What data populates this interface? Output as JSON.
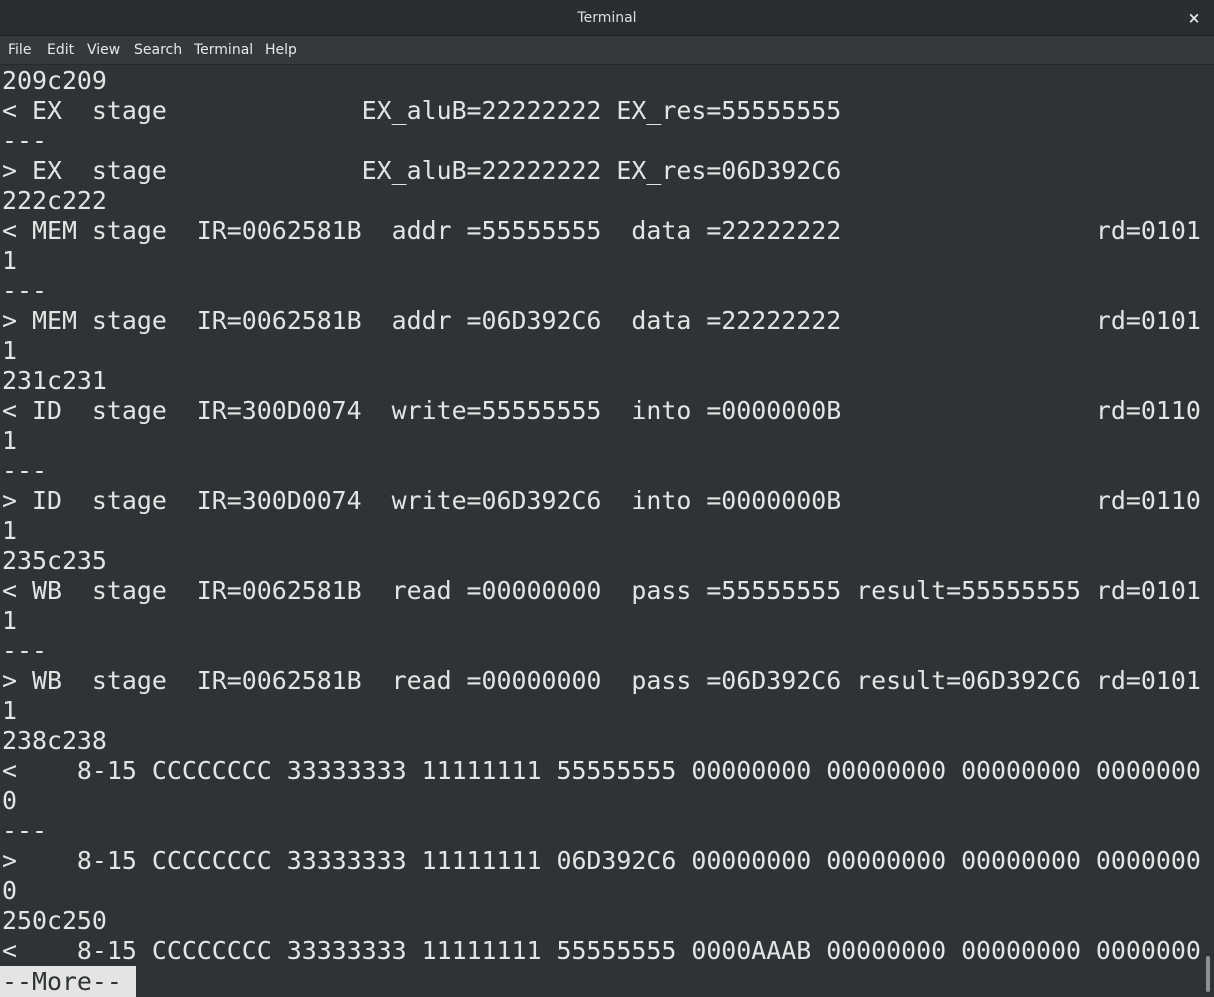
{
  "window": {
    "title": "Terminal",
    "close_label": "×"
  },
  "menu": {
    "items": [
      "File",
      "Edit",
      "View",
      "Search",
      "Terminal",
      "Help"
    ]
  },
  "terminal": {
    "lines": [
      "209c209",
      "< EX  stage             EX_aluB=22222222 EX_res=55555555",
      "---",
      "> EX  stage             EX_aluB=22222222 EX_res=06D392C6",
      "222c222",
      "< MEM stage  IR=0062581B  addr =55555555  data =22222222                 rd=0101",
      "1",
      "---",
      "> MEM stage  IR=0062581B  addr =06D392C6  data =22222222                 rd=0101",
      "1",
      "231c231",
      "< ID  stage  IR=300D0074  write=55555555  into =0000000B                 rd=0110",
      "1",
      "---",
      "> ID  stage  IR=300D0074  write=06D392C6  into =0000000B                 rd=0110",
      "1",
      "235c235",
      "< WB  stage  IR=0062581B  read =00000000  pass =55555555 result=55555555 rd=0101",
      "1",
      "---",
      "> WB  stage  IR=0062581B  read =00000000  pass =06D392C6 result=06D392C6 rd=0101",
      "1",
      "238c238",
      "<    8-15 CCCCCCCC 33333333 11111111 55555555 00000000 00000000 00000000 0000000",
      "0",
      "---",
      ">    8-15 CCCCCCCC 33333333 11111111 06D392C6 00000000 00000000 00000000 0000000",
      "0",
      "250c250",
      "<    8-15 CCCCCCCC 33333333 11111111 55555555 0000AAAB 00000000 00000000 0000000"
    ],
    "pager_prompt": "--More--"
  },
  "colors": {
    "background": "#2e3436",
    "foreground": "#e4e4e4",
    "titlebar": "#2b2e30",
    "menubar": "#35393b"
  }
}
